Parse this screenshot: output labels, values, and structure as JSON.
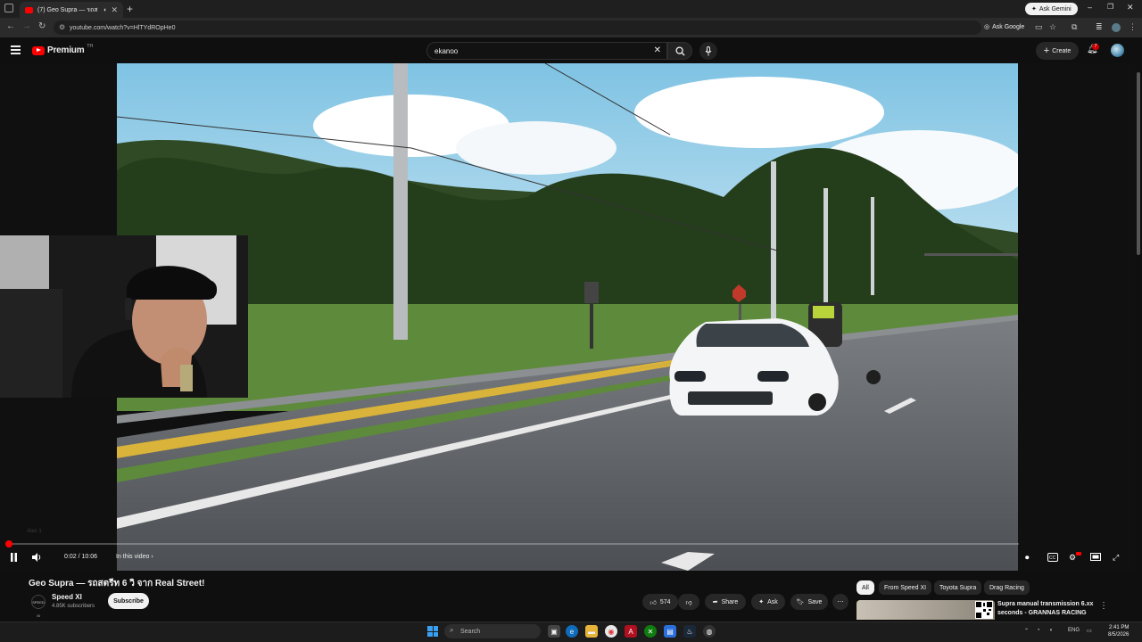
{
  "browser": {
    "tab_title": "(7) Geo Supra — รถสตรีท 6 วิ",
    "tab_close": "✕",
    "new_tab": "+",
    "ask_gemini": "Ask Gemini",
    "url": "youtube.com/watch?v=HlTYdROpHe0",
    "ask_google": "Ask Google"
  },
  "yt_header": {
    "logo_text": "Premium",
    "logo_sup": "TH",
    "search_value": "ekanoo",
    "create_label": "Create",
    "notification_count": "7"
  },
  "player": {
    "buffer_hint": "Alex 1",
    "current_time": "0:02",
    "duration": "10:06",
    "time_separator": " / ",
    "in_this_video": "In this video",
    "progress_fraction": 0.0033
  },
  "video": {
    "title": "Geo Supra — รถสตรีท 6 วิ จาก Real Street!",
    "channel_name": "Speed XI",
    "channel_avatar_text": "SPEED XI",
    "subscribers": "4.85K subscribers",
    "subscribe_label": "Subscribe",
    "likes": "574",
    "share_label": "Share",
    "ask_label": "Ask",
    "save_label": "Save"
  },
  "chips": [
    "All",
    "From Speed XI",
    "Toyota Supra",
    "Drag Racing"
  ],
  "recommendation": {
    "title": "Supra manual transmission 6.xx seconds - GRANNAS RACING"
  },
  "taskbar": {
    "search_placeholder": "Search",
    "language": "ENG",
    "time": "2:41 PM",
    "date": "8/5/2026"
  },
  "colors": {
    "background": "#0f0f0f",
    "accent_red": "#ff0000",
    "chip_active": "#f1f1f1"
  }
}
